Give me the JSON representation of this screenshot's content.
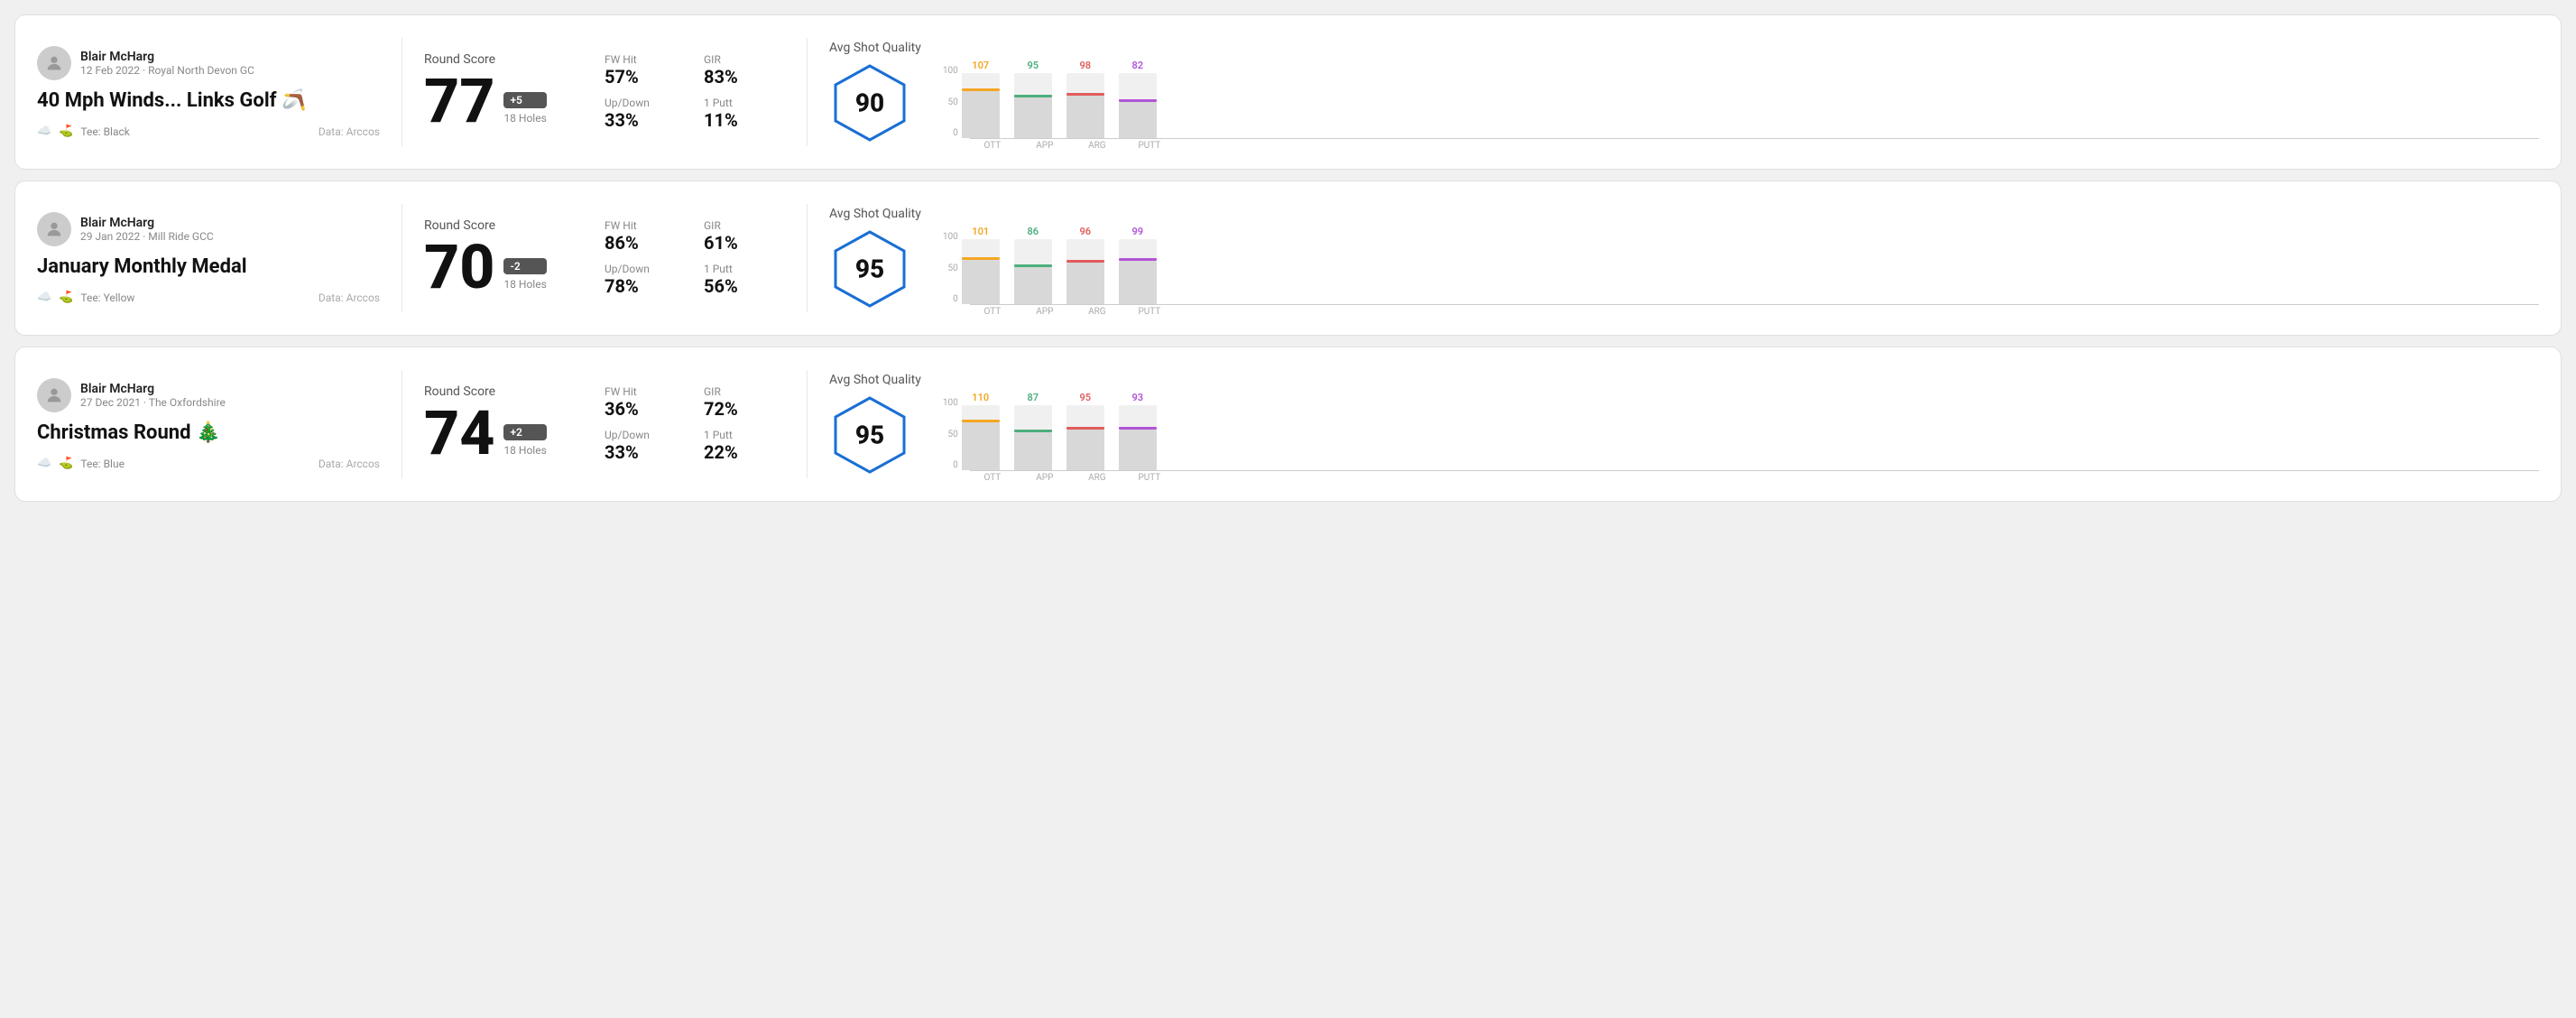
{
  "rounds": [
    {
      "id": "round1",
      "user": {
        "name": "Blair McHarg",
        "date_course": "12 Feb 2022 · Royal North Devon GC"
      },
      "title": "40 Mph Winds... Links Golf 🪃",
      "tee": "Black",
      "data_source": "Data: Arccos",
      "score": {
        "label": "Round Score",
        "number": "77",
        "badge": "+5",
        "holes": "18 Holes"
      },
      "stats": [
        {
          "label": "FW Hit",
          "value": "57%"
        },
        {
          "label": "GIR",
          "value": "83%"
        },
        {
          "label": "Up/Down",
          "value": "33%"
        },
        {
          "label": "1 Putt",
          "value": "11%"
        }
      ],
      "quality": {
        "label": "Avg Shot Quality",
        "score": "90"
      },
      "chart": {
        "bars": [
          {
            "label": "OTT",
            "value": 107,
            "color": "#f5a623",
            "pct": 72
          },
          {
            "label": "APP",
            "value": 95,
            "color": "#4caf7d",
            "pct": 63
          },
          {
            "label": "ARG",
            "value": 98,
            "color": "#e05c5c",
            "pct": 65
          },
          {
            "label": "PUTT",
            "value": 82,
            "color": "#b055d6",
            "pct": 55
          }
        ],
        "y_labels": [
          "100",
          "50",
          "0"
        ]
      }
    },
    {
      "id": "round2",
      "user": {
        "name": "Blair McHarg",
        "date_course": "29 Jan 2022 · Mill Ride GCC"
      },
      "title": "January Monthly Medal",
      "tee": "Yellow",
      "data_source": "Data: Arccos",
      "score": {
        "label": "Round Score",
        "number": "70",
        "badge": "-2",
        "holes": "18 Holes"
      },
      "stats": [
        {
          "label": "FW Hit",
          "value": "86%"
        },
        {
          "label": "GIR",
          "value": "61%"
        },
        {
          "label": "Up/Down",
          "value": "78%"
        },
        {
          "label": "1 Putt",
          "value": "56%"
        }
      ],
      "quality": {
        "label": "Avg Shot Quality",
        "score": "95"
      },
      "chart": {
        "bars": [
          {
            "label": "OTT",
            "value": 101,
            "color": "#f5a623",
            "pct": 68
          },
          {
            "label": "APP",
            "value": 86,
            "color": "#4caf7d",
            "pct": 57
          },
          {
            "label": "ARG",
            "value": 96,
            "color": "#e05c5c",
            "pct": 64
          },
          {
            "label": "PUTT",
            "value": 99,
            "color": "#b055d6",
            "pct": 66
          }
        ],
        "y_labels": [
          "100",
          "50",
          "0"
        ]
      }
    },
    {
      "id": "round3",
      "user": {
        "name": "Blair McHarg",
        "date_course": "27 Dec 2021 · The Oxfordshire"
      },
      "title": "Christmas Round 🎄",
      "tee": "Blue",
      "data_source": "Data: Arccos",
      "score": {
        "label": "Round Score",
        "number": "74",
        "badge": "+2",
        "holes": "18 Holes"
      },
      "stats": [
        {
          "label": "FW Hit",
          "value": "36%"
        },
        {
          "label": "GIR",
          "value": "72%"
        },
        {
          "label": "Up/Down",
          "value": "33%"
        },
        {
          "label": "1 Putt",
          "value": "22%"
        }
      ],
      "quality": {
        "label": "Avg Shot Quality",
        "score": "95"
      },
      "chart": {
        "bars": [
          {
            "label": "OTT",
            "value": 110,
            "color": "#f5a623",
            "pct": 74
          },
          {
            "label": "APP",
            "value": 87,
            "color": "#4caf7d",
            "pct": 58
          },
          {
            "label": "ARG",
            "value": 95,
            "color": "#e05c5c",
            "pct": 63
          },
          {
            "label": "PUTT",
            "value": 93,
            "color": "#b055d6",
            "pct": 62
          }
        ],
        "y_labels": [
          "100",
          "50",
          "0"
        ]
      }
    }
  ]
}
